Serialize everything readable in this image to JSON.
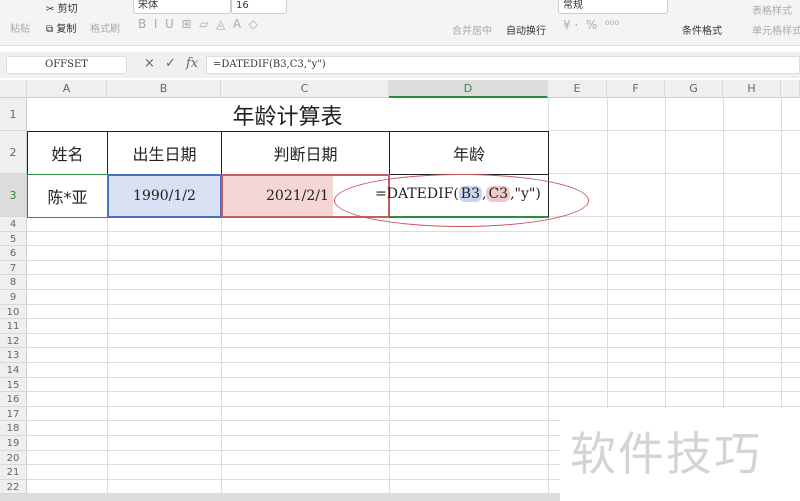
{
  "ribbon": {
    "paste": "粘贴",
    "cut": "剪切",
    "copy": "复制",
    "format_painter": "格式刷",
    "font_name": "宋体",
    "font_size": "16",
    "merge_center": "合并居中",
    "wrap_text": "自动换行",
    "number_format": "常规",
    "conditional_format": "条件格式",
    "table_style": "表格样式",
    "cell_style": "单元格样式"
  },
  "formula_bar": {
    "name_box": "OFFSET",
    "cancel": "×",
    "confirm": "✓",
    "fx": "fx",
    "formula": "=DATEDIF(B3,C3,\"y\")"
  },
  "columns": [
    "A",
    "B",
    "C",
    "D",
    "E",
    "F",
    "G",
    "H"
  ],
  "rows": [
    "1",
    "2",
    "3",
    "4",
    "5",
    "6",
    "7",
    "8",
    "9",
    "10",
    "11",
    "12",
    "13",
    "14",
    "15",
    "16",
    "17",
    "18",
    "19",
    "20",
    "21",
    "22"
  ],
  "sheet": {
    "title": "年龄计算表",
    "headers": [
      "姓名",
      "出生日期",
      "判断日期",
      "年龄"
    ],
    "row3": {
      "name": "陈*亚",
      "birth": "1990/1/2",
      "judge": "2021/2/1",
      "formula_prefix": "=DATEDIF(",
      "ref1": "B3",
      "sep1": ",",
      "ref2": "C3",
      "suffix": ",\"y\")"
    }
  },
  "watermark": "软件技巧"
}
